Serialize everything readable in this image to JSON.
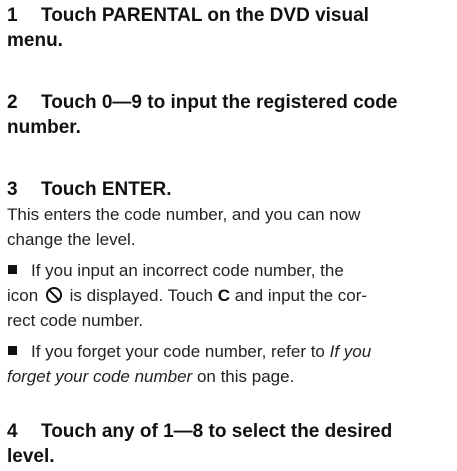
{
  "steps": [
    {
      "number": "1",
      "title_line1": "Touch PARENTAL on the DVD visual",
      "title_line2": "menu."
    },
    {
      "number": "2",
      "title_line1": "Touch 0—9 to input the registered code",
      "title_line2": "number."
    },
    {
      "number": "3",
      "title_line1": "Touch ENTER."
    },
    {
      "number": "4",
      "title_line1": "Touch any of 1—8 to select the desired",
      "title_line2": "level."
    }
  ],
  "step3_body": {
    "line1": "This enters the code number, and you can now",
    "line2": "change the level.",
    "bullet1": {
      "line1": "If you input an incorrect code number, the",
      "line2_before_icon": "icon",
      "line2_after_icon": "is displayed. Touch",
      "key": "C",
      "line2_end": "and input the cor-",
      "line3": "rect code number."
    },
    "bullet2": {
      "line1_before": "If you forget your code number, refer to",
      "line1_italic": "If you",
      "line2_italic": "forget your code number",
      "line2_after": "on this page."
    }
  },
  "icons": {
    "prohibit": "prohibited-circle-icon",
    "bullet": "square-bullet"
  }
}
